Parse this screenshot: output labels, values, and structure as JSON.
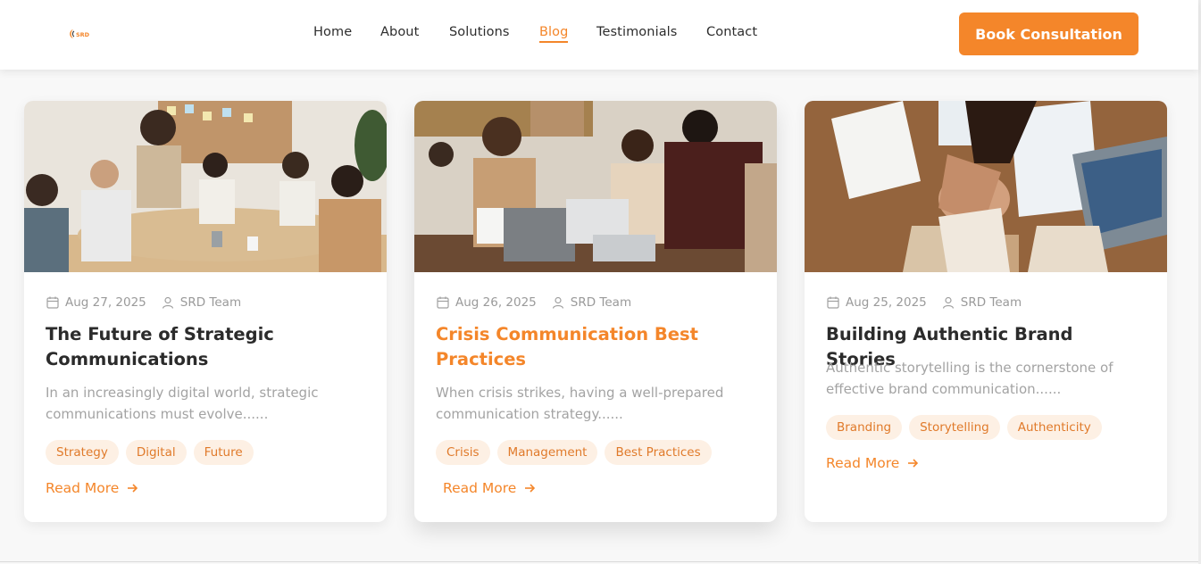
{
  "brand": {
    "logo_text": "SRD",
    "accent_color": "#f4862a"
  },
  "nav": {
    "items": [
      {
        "label": "Home"
      },
      {
        "label": "About"
      },
      {
        "label": "Solutions"
      },
      {
        "label": "Blog",
        "active": true
      },
      {
        "label": "Testimonials"
      },
      {
        "label": "Contact"
      }
    ],
    "cta_label": "Book Consultation"
  },
  "posts": [
    {
      "date": "Aug 27, 2025",
      "author": "SRD Team",
      "title": "The Future of Strategic Communications",
      "excerpt": "In an increasingly digital world, strategic communications must evolve......",
      "tags": [
        "Strategy",
        "Digital",
        "Future"
      ],
      "read_more": "Read More",
      "image": "team-meeting-handshake-photo"
    },
    {
      "date": "Aug 26, 2025",
      "author": "SRD Team",
      "title": "Crisis Communication Best Practices",
      "excerpt": "When crisis strikes, having a well-prepared communication strategy......",
      "tags": [
        "Crisis",
        "Management",
        "Best Practices"
      ],
      "read_more": "Read More",
      "image": "team-discussion-laptops-photo"
    },
    {
      "date": "Aug 25, 2025",
      "author": "SRD Team",
      "title": "Building Authentic Brand Stories",
      "excerpt": "Authentic storytelling is the cornerstone of effective brand communication......",
      "tags": [
        "Branding",
        "Storytelling",
        "Authenticity"
      ],
      "read_more": "Read More",
      "image": "stacked-hands-teamwork-photo"
    }
  ]
}
